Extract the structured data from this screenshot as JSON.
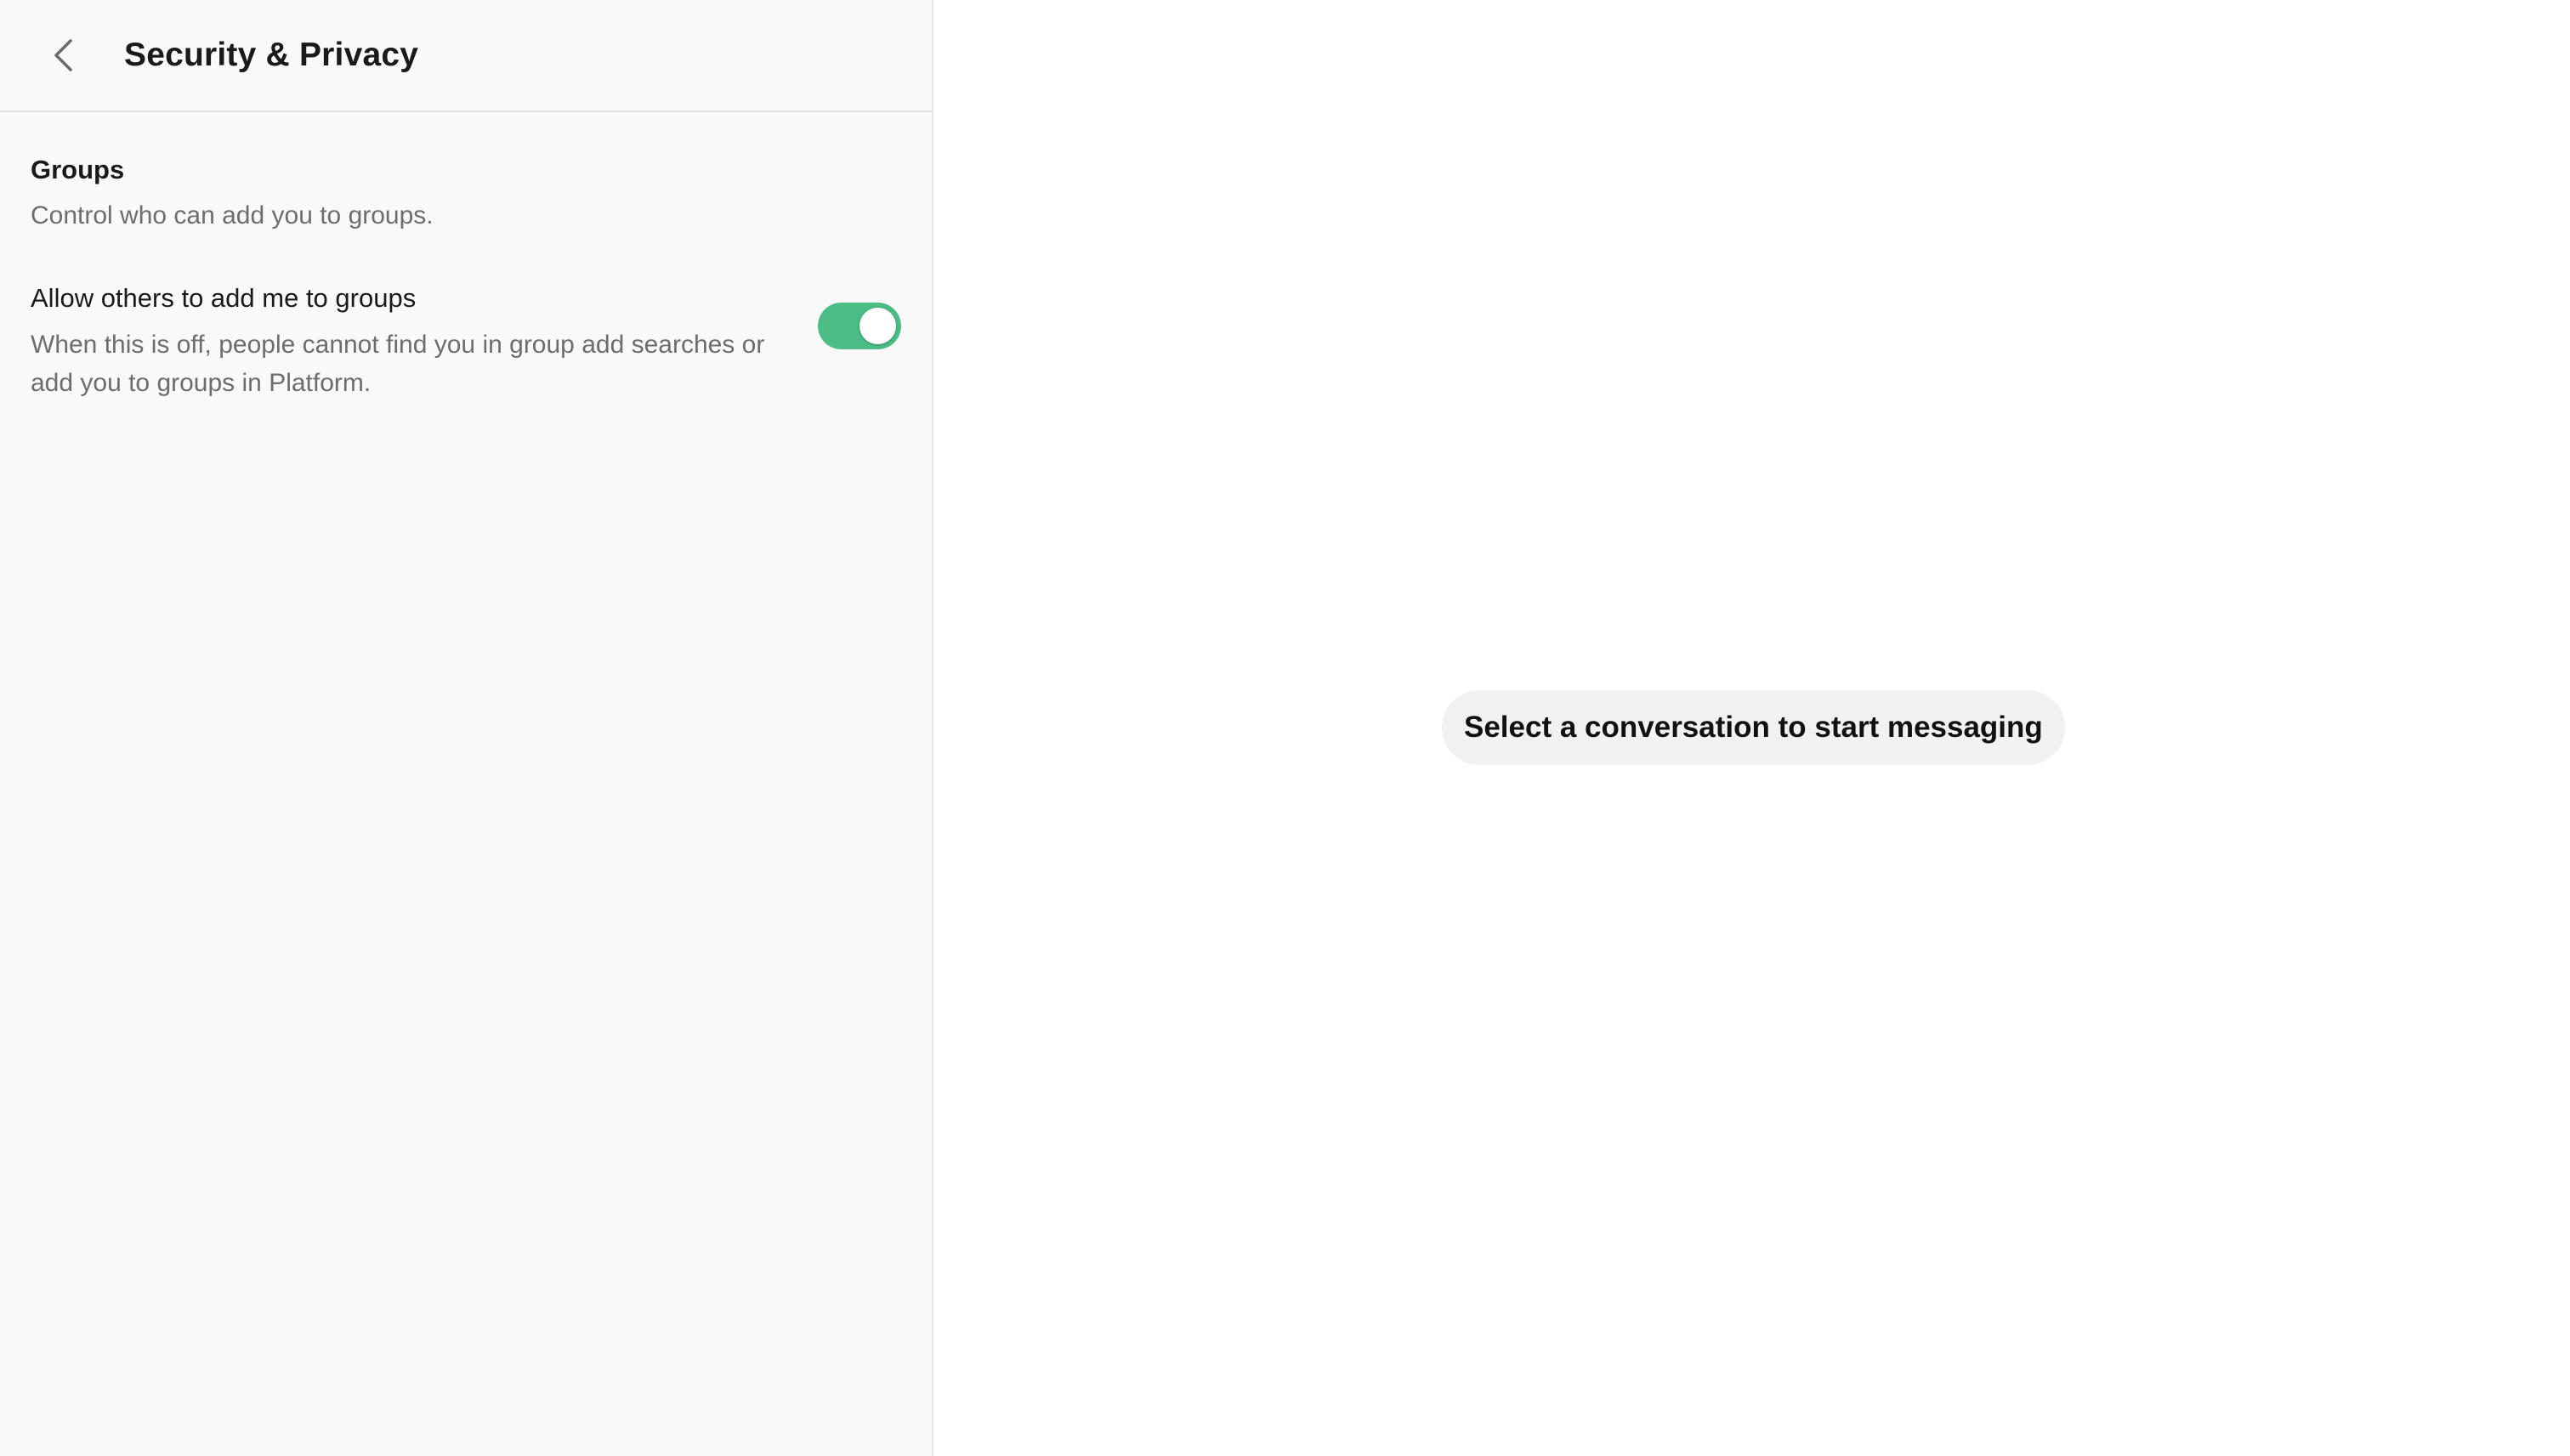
{
  "header": {
    "title": "Security & Privacy",
    "back_icon": "chevron-left-icon"
  },
  "groups_section": {
    "title": "Groups",
    "description": "Control who can add you to groups."
  },
  "allow_add_setting": {
    "label": "Allow others to add me to groups",
    "description": "When this is off, people cannot find you in group add searches or add you to groups in Platform.",
    "enabled": true,
    "toggle_color": "#4cbd85"
  },
  "main": {
    "empty_state": "Select a conversation to start messaging"
  }
}
